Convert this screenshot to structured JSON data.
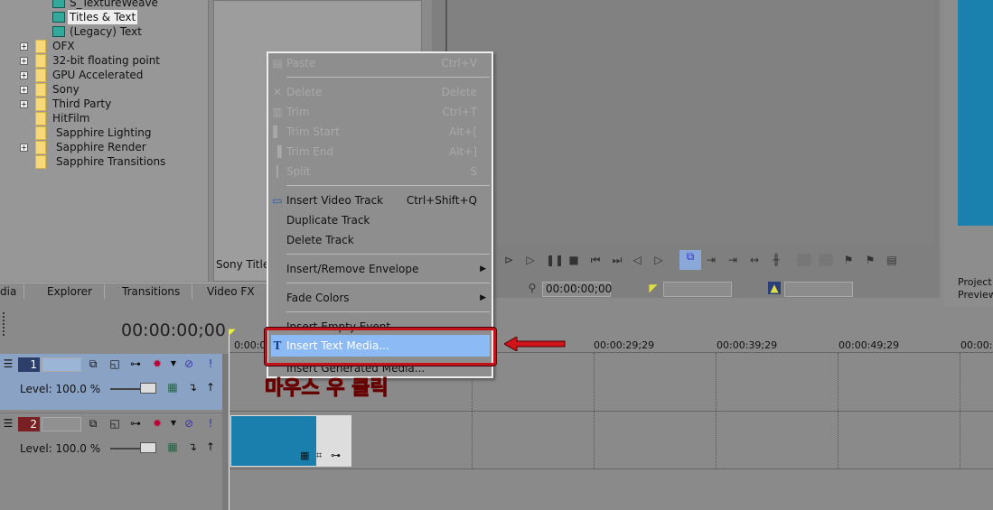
{
  "tree": {
    "items": [
      {
        "label": "S_TextureWeave",
        "type": "fx",
        "expandable": false
      },
      {
        "label": "Titles & Text",
        "type": "fx",
        "expandable": false,
        "selected": true
      },
      {
        "label": "(Legacy) Text",
        "type": "fx",
        "expandable": false
      },
      {
        "label": "OFX",
        "type": "folder",
        "expandable": true
      },
      {
        "label": "32-bit floating point",
        "type": "folder",
        "expandable": true
      },
      {
        "label": "GPU Accelerated",
        "type": "folder",
        "expandable": true
      },
      {
        "label": "Sony",
        "type": "folder",
        "expandable": true
      },
      {
        "label": "Third Party",
        "type": "folder",
        "expandable": true
      },
      {
        "label": "HitFilm",
        "type": "folder",
        "expandable": false
      },
      {
        "label": "Sapphire Lighting",
        "type": "folder",
        "expandable": false
      },
      {
        "label": "Sapphire Render",
        "type": "folder",
        "expandable": true
      },
      {
        "label": "Sapphire Transitions",
        "type": "folder",
        "expandable": false
      }
    ]
  },
  "list_label": "Sony Title",
  "tabs": [
    "dia",
    "Explorer",
    "Transitions",
    "Video FX"
  ],
  "preview": {
    "cursor_time": "00:00:00;00",
    "side_label_1": "Project",
    "side_label_2": "Preview"
  },
  "timeline": {
    "timecode": "00:00:00;00",
    "ruler": [
      "0:00:0",
      "00:00:29;29",
      "00:00:39;29",
      "00:00:49;29",
      "00:00:5"
    ],
    "tracks": [
      {
        "number": "1",
        "level": "Level: 100.0 %",
        "color": "#2b3f6a"
      },
      {
        "number": "2",
        "level": "Level: 100.0 %",
        "color": "#7a1f24"
      }
    ]
  },
  "context_menu": {
    "items": [
      {
        "label": "Paste",
        "shortcut": "Ctrl+V",
        "disabled": true,
        "icon": "paste-icon"
      },
      {
        "label": "Delete",
        "shortcut": "Delete",
        "disabled": true,
        "icon": "delete-x-icon"
      },
      {
        "label": "Trim",
        "shortcut": "Ctrl+T",
        "disabled": true,
        "icon": "trim-icon"
      },
      {
        "label": "Trim Start",
        "shortcut": "Alt+[",
        "disabled": true,
        "icon": "trim-start-icon"
      },
      {
        "label": "Trim End",
        "shortcut": "Alt+]",
        "disabled": true,
        "icon": "trim-end-icon"
      },
      {
        "label": "Split",
        "shortcut": "S",
        "disabled": true,
        "icon": "split-icon"
      },
      {
        "label": "Insert Video Track",
        "shortcut": "Ctrl+Shift+Q",
        "disabled": false,
        "icon": "video-track-icon"
      },
      {
        "label": "Duplicate Track",
        "shortcut": "",
        "disabled": false
      },
      {
        "label": "Delete Track",
        "shortcut": "",
        "disabled": false
      },
      {
        "label": "Insert/Remove Envelope",
        "shortcut": "",
        "disabled": false,
        "submenu": true
      },
      {
        "label": "Fade Colors",
        "shortcut": "",
        "disabled": false,
        "submenu": true
      },
      {
        "label": "Insert Empty Event",
        "shortcut": "",
        "disabled": false
      },
      {
        "label": "Insert Text Media...",
        "shortcut": "",
        "disabled": false,
        "highlighted": true,
        "icon": "text-t-icon"
      },
      {
        "label": "Insert Generated Media...",
        "shortcut": "",
        "disabled": false
      }
    ]
  },
  "annotation": {
    "text": "마우스 우 클릭",
    "color": "#d0141a"
  },
  "colors": {
    "accent_blue": "#1a80ad",
    "highlight": "#8cbaf5",
    "annotation_red": "#c0141a"
  }
}
